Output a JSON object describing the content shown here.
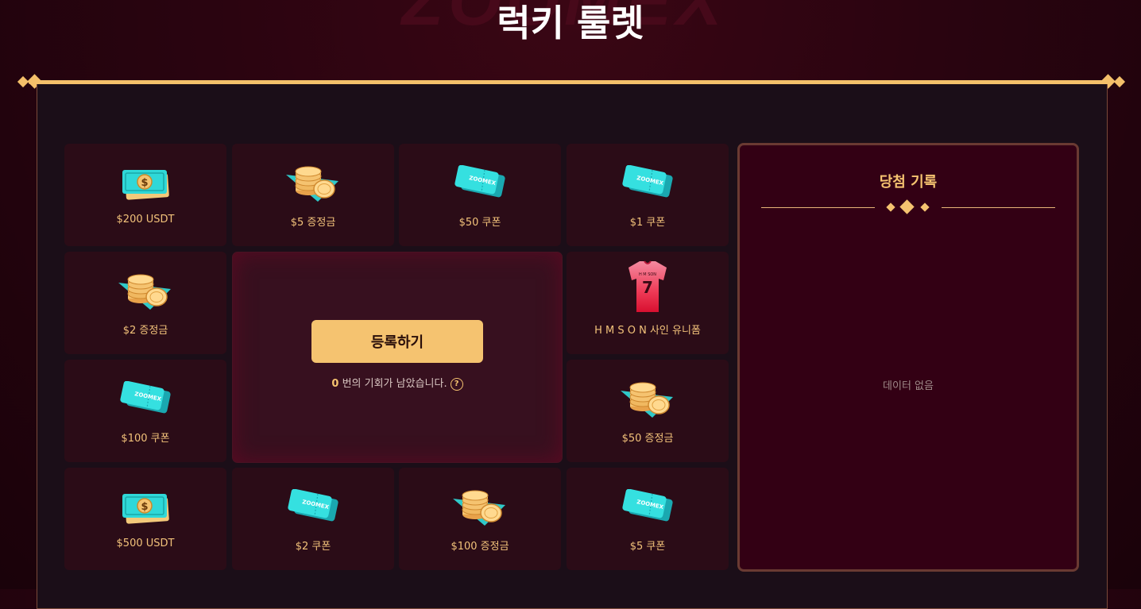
{
  "watermark": "ZOOMEX",
  "title": "럭키 룰렛",
  "prizes": {
    "p200usdt": {
      "label": "$200 USDT",
      "icon": "cash-icon"
    },
    "p5bonus": {
      "label": "$5 증정금",
      "icon": "coins-icon"
    },
    "p50coupon": {
      "label": "$50 쿠폰",
      "icon": "coupon-icon"
    },
    "p1coupon": {
      "label": "$1 쿠폰",
      "icon": "coupon-icon"
    },
    "p2bonus": {
      "label": "$2 증정금",
      "icon": "coins-icon"
    },
    "puniform": {
      "label": "H M S O N 사인 유니폼",
      "icon": "jersey-icon",
      "jersey_text": "H M SON",
      "jersey_number": "7"
    },
    "p100coupon": {
      "label": "$100 쿠폰",
      "icon": "coupon-icon"
    },
    "p50bonus": {
      "label": "$50 증정금",
      "icon": "coins-icon"
    },
    "p500usdt": {
      "label": "$500 USDT",
      "icon": "cash-icon"
    },
    "p2coupon": {
      "label": "$2 쿠폰",
      "icon": "coupon-icon"
    },
    "p100bonus": {
      "label": "$100 증정금",
      "icon": "coins-icon"
    },
    "p5coupon": {
      "label": "$5 쿠폰",
      "icon": "coupon-icon"
    }
  },
  "coupon_brand": "ZOOMEX",
  "action": {
    "register_label": "등록하기",
    "chances_count": "0",
    "chances_text": " 번의 기회가 남았습니다."
  },
  "history": {
    "title": "당첨 기록",
    "empty": "데이터 없음"
  },
  "colors": {
    "accent": "#f5c370",
    "background": "#2a0410",
    "panel": "#1b0e18",
    "cell": "#2b0c17",
    "history_bg": "#330014"
  }
}
